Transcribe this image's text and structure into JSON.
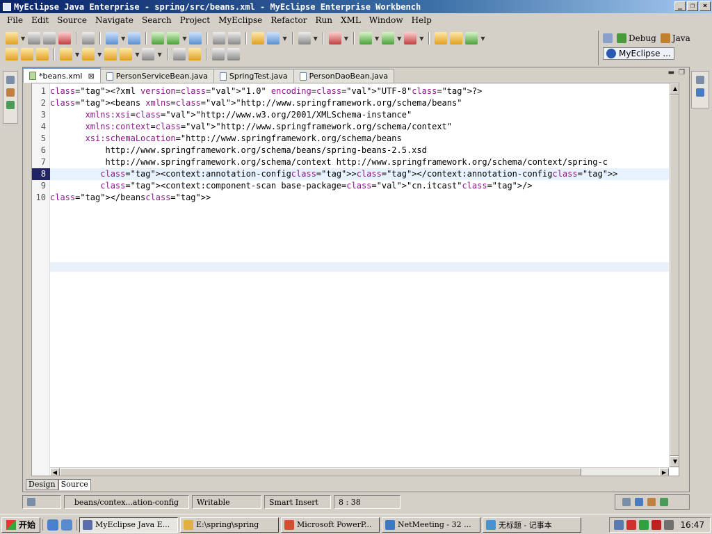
{
  "window": {
    "title": "MyEclipse Java Enterprise - spring/src/beans.xml - MyEclipse Enterprise Workbench"
  },
  "menu": [
    "File",
    "Edit",
    "Source",
    "Navigate",
    "Search",
    "Project",
    "MyEclipse",
    "Refactor",
    "Run",
    "XML",
    "Window",
    "Help"
  ],
  "perspectives": {
    "debug": "Debug",
    "java": "Java",
    "active": "MyEclipse ..."
  },
  "tabs": [
    {
      "label": "*beans.xml",
      "icon": "xml-file-icon",
      "active": true
    },
    {
      "label": "PersonServiceBean.java",
      "icon": "java-file-icon",
      "active": false
    },
    {
      "label": "SpringTest.java",
      "icon": "java-file-icon",
      "active": false
    },
    {
      "label": "PersonDaoBean.java",
      "icon": "java-file-icon",
      "active": false
    }
  ],
  "editor": {
    "current_line": 8,
    "lines": [
      {
        "num": "1",
        "text": "<?xml version=\"1.0\" encoding=\"UTF-8\"?>"
      },
      {
        "num": "2",
        "text": "<beans xmlns=\"http://www.springframework.org/schema/beans\""
      },
      {
        "num": "3",
        "text": "       xmlns:xsi=\"http://www.w3.org/2001/XMLSchema-instance\""
      },
      {
        "num": "4",
        "text": "       xmlns:context=\"http://www.springframework.org/schema/context\""
      },
      {
        "num": "5",
        "text": "       xsi:schemaLocation=\"http://www.springframework.org/schema/beans"
      },
      {
        "num": "6",
        "text": "           http://www.springframework.org/schema/beans/spring-beans-2.5.xsd"
      },
      {
        "num": "7",
        "text": "           http://www.springframework.org/schema/context http://www.springframework.org/schema/context/spring-c"
      },
      {
        "num": "8",
        "text": "          <context:annotation-config></context:annotation-config>"
      },
      {
        "num": "9",
        "text": "          <context:component-scan base-package=\"cn.itcast\"/>"
      },
      {
        "num": "10",
        "text": "</beans>"
      }
    ]
  },
  "mode_tabs": {
    "design": "Design",
    "source": "Source"
  },
  "status": {
    "path": "beans/contex...ation-config",
    "writable": "Writable",
    "insert_mode": "Smart Insert",
    "position": "8 : 38"
  },
  "taskbar": {
    "start": "开始",
    "tasks": [
      {
        "label": "MyEclipse Java E...",
        "active": true,
        "color": "#5a6ea8"
      },
      {
        "label": "E:\\spring\\spring",
        "active": false,
        "color": "#e0b040"
      },
      {
        "label": "Microsoft PowerP...",
        "active": false,
        "color": "#d05030"
      },
      {
        "label": "NetMeeting - 32 ...",
        "active": false,
        "color": "#3a7ac0"
      },
      {
        "label": "无标题 - 记事本",
        "active": false,
        "color": "#4a90d0"
      }
    ],
    "clock": "16:47"
  }
}
